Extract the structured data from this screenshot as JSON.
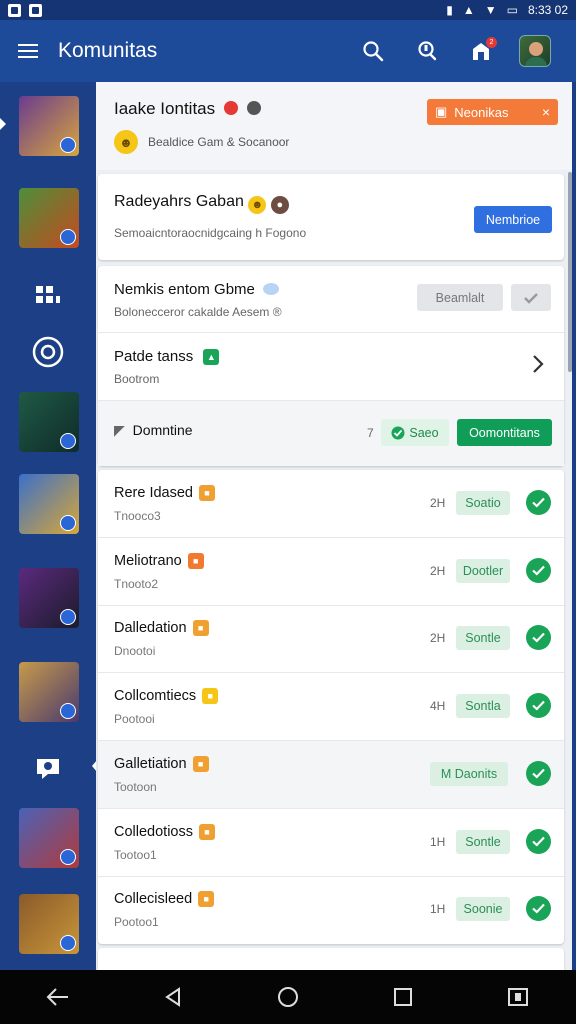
{
  "status": {
    "time": "8:33 02",
    "sim": "4G"
  },
  "appbar": {
    "title": "Komunitas",
    "notif_count": "2"
  },
  "rail": {
    "items": [
      {
        "name": "game-kingdom",
        "colors": [
          "#6a3c8f",
          "#d8a53c"
        ]
      },
      {
        "name": "game-warrior",
        "colors": [
          "#4c8f3a",
          "#c64a1f"
        ]
      },
      {
        "name": "game-hero",
        "colors": [
          "#1f5a44",
          "#0f2b2a"
        ]
      },
      {
        "name": "game-clash",
        "colors": [
          "#3c70c9",
          "#d8a736"
        ]
      },
      {
        "name": "game-arena",
        "colors": [
          "#5b2a7e",
          "#1b1b2a"
        ]
      },
      {
        "name": "game-legend",
        "colors": [
          "#c79a4a",
          "#4a3a6e"
        ]
      },
      {
        "name": "game-raid",
        "colors": [
          "#4a62b8",
          "#b23a3a"
        ]
      },
      {
        "name": "game-chest",
        "colors": [
          "#8a5a2a",
          "#c9963a"
        ]
      }
    ]
  },
  "header_card": {
    "title": "Iaake Iontitas",
    "subtitle": "Bealdice Gam & Socanoor",
    "tag_label": "Neonikas",
    "tag_close": "×"
  },
  "invite_card": {
    "title": "Radeyahrs Gaban",
    "subtitle": "Semoaicntoraocnidgcaing h Fogono",
    "button": "Nembrioe"
  },
  "group_card": {
    "row1": {
      "title": "Nemkis entom Gbme",
      "subtitle": "Bolonecceror cakalde Aesem ®",
      "button": "Beamlalt"
    },
    "row2": {
      "title": "Patde tanss",
      "subtitle": "Bootrom"
    },
    "row3": {
      "label": "Domntine",
      "count": "7",
      "pill": "Saeo",
      "button": "Oomontitans"
    }
  },
  "list": [
    {
      "name": "Rere Idased",
      "meta": "Tnooco3",
      "count": "2H",
      "status": "Soatio",
      "badge_color": "#f0a030"
    },
    {
      "name": "Meliotrano",
      "meta": "Tnooto2",
      "count": "2H",
      "status": "Dootler",
      "badge_color": "#f07a30"
    },
    {
      "name": "Dalledation",
      "meta": "Dnootoi",
      "count": "2H",
      "status": "Sontle",
      "badge_color": "#f0a030"
    },
    {
      "name": "Collcomtiecs",
      "meta": "Pootooi",
      "count": "4H",
      "status": "Sontla",
      "badge_color": "#f5c518"
    },
    {
      "name": "Galletiation",
      "meta": "Tootoon",
      "count": "",
      "status": "M Daonits",
      "badge_color": "#f0a030"
    },
    {
      "name": "Colledotioss",
      "meta": "Tootoo1",
      "count": "1H",
      "status": "Sontle",
      "badge_color": "#f0a030"
    },
    {
      "name": "Collecisleed",
      "meta": "Pootoo1",
      "count": "1H",
      "status": "Soonie",
      "badge_color": "#f0a030"
    }
  ],
  "colors": {
    "accent": "#1e4a9a",
    "green": "#19a457",
    "orange": "#f47a3a",
    "blue_btn": "#2f6fe0"
  }
}
